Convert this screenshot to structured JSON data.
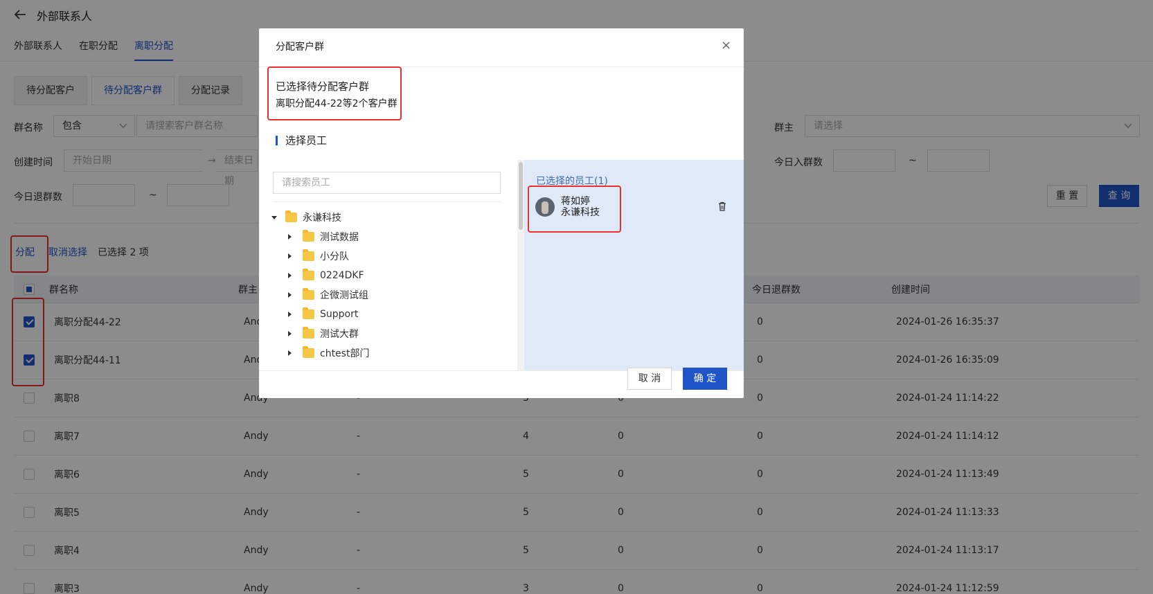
{
  "header": {
    "title": "外部联系人"
  },
  "tabs": [
    {
      "label": "外部联系人"
    },
    {
      "label": "在职分配"
    },
    {
      "label": "离职分配"
    }
  ],
  "subtabs": [
    {
      "label": "待分配客户"
    },
    {
      "label": "待分配客户群"
    },
    {
      "label": "分配记录"
    }
  ],
  "filters": {
    "group_name_label": "群名称",
    "group_name_op": "包含",
    "group_name_placeholder": "请搜索客户群名称",
    "owner_label": "群主",
    "owner_placeholder": "请选择",
    "created_label": "创建时间",
    "start_placeholder": "开始日期",
    "end_placeholder": "结束日期",
    "today_join_label": "今日入群数",
    "today_quit_label": "今日退群数",
    "tilde": "~",
    "reset": "重 置",
    "query": "查 询"
  },
  "actions": {
    "assign": "分配",
    "cancel_select": "取消选择",
    "selected_count": "已选择 2 项"
  },
  "table": {
    "headers": {
      "name": "群名称",
      "owner": "群主",
      "today_quit": "今日退群数",
      "created": "创建时间"
    },
    "rows": [
      {
        "name": "离职分配44-22",
        "owner": "Andy",
        "col3": "",
        "col4": "",
        "col5": "",
        "quit": "0",
        "time": "2024-01-26 16:35:37",
        "checked": true
      },
      {
        "name": "离职分配44-11",
        "owner": "Andy",
        "col3": "",
        "col4": "",
        "col5": "",
        "quit": "0",
        "time": "2024-01-26 16:35:09",
        "checked": true
      },
      {
        "name": "离职8",
        "owner": "Andy",
        "col3": "-",
        "col4": "3",
        "col5": "0",
        "quit": "0",
        "time": "2024-01-24 11:14:22",
        "checked": false
      },
      {
        "name": "离职7",
        "owner": "Andy",
        "col3": "-",
        "col4": "4",
        "col5": "0",
        "quit": "0",
        "time": "2024-01-24 11:14:12",
        "checked": false
      },
      {
        "name": "离职6",
        "owner": "Andy",
        "col3": "-",
        "col4": "5",
        "col5": "0",
        "quit": "0",
        "time": "2024-01-24 11:13:49",
        "checked": false
      },
      {
        "name": "离职5",
        "owner": "Andy",
        "col3": "-",
        "col4": "5",
        "col5": "0",
        "quit": "0",
        "time": "2024-01-24 11:13:33",
        "checked": false
      },
      {
        "name": "离职4",
        "owner": "Andy",
        "col3": "-",
        "col4": "5",
        "col5": "0",
        "quit": "0",
        "time": "2024-01-24 11:13:17",
        "checked": false
      },
      {
        "name": "离职3",
        "owner": "Andy",
        "col3": "-",
        "col4": "3",
        "col5": "0",
        "quit": "0",
        "time": "2024-01-24 11:12:59",
        "checked": false
      }
    ]
  },
  "modal": {
    "title": "分配客户群",
    "close": "×",
    "selected_heading": "已选择待分配客户群",
    "selected_desc": "离职分配44-22等2个客户群",
    "section_title": "选择员工",
    "search_placeholder": "请搜索员工",
    "tree": {
      "root": "永谦科技",
      "children": [
        "测试数据",
        "小分队",
        "0224DKF",
        "企微测试组",
        "Support",
        "测试大群",
        "chtest部门"
      ]
    },
    "chosen_title": "已选择的员工(1)",
    "chosen": {
      "name": "蒋如婷",
      "dept": "永谦科技"
    },
    "cancel": "取 消",
    "confirm": "确 定"
  },
  "colors": {
    "accent": "#1f55c8",
    "highlight": "#e8302f",
    "selected_panel": "#dfe9f7"
  }
}
